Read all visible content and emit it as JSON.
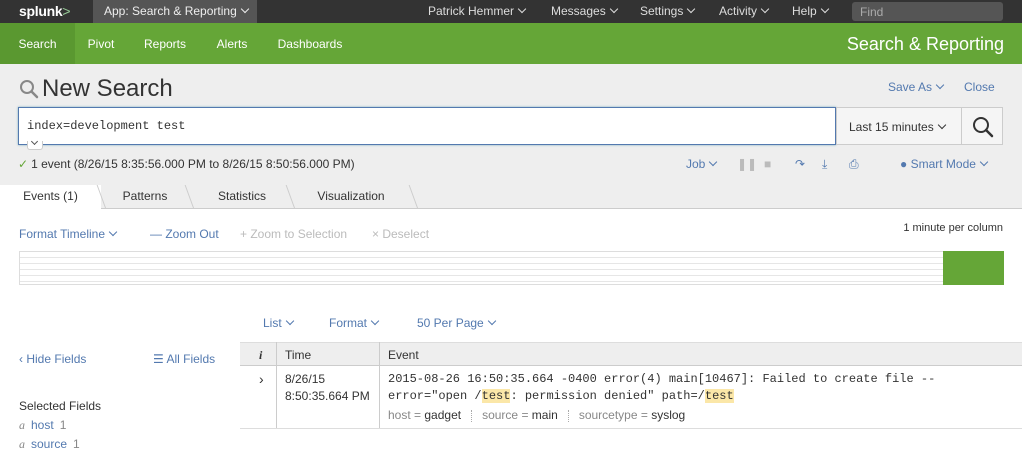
{
  "topbar": {
    "logo": "splunk",
    "logo_suffix": ">",
    "app_menu": "App: Search & Reporting",
    "nav": [
      "Patrick Hemmer",
      "Messages",
      "Settings",
      "Activity",
      "Help"
    ],
    "find_placeholder": "Find"
  },
  "appbar": {
    "tabs": [
      "Search",
      "Pivot",
      "Reports",
      "Alerts",
      "Dashboards"
    ],
    "title": "Search & Reporting"
  },
  "search": {
    "title": "New Search",
    "save_as": "Save As",
    "close": "Close",
    "query": "index=development test",
    "time_range": "Last 15 minutes",
    "status": "1 event (8/26/15 8:35:56.000 PM to 8/26/15 8:50:56.000 PM)",
    "job": "Job",
    "mode": "Smart Mode"
  },
  "tabs": [
    "Events (1)",
    "Patterns",
    "Statistics",
    "Visualization"
  ],
  "timeline": {
    "format": "Format Timeline",
    "zoom_out": "Zoom Out",
    "zoom_selection": "Zoom to Selection",
    "deselect": "Deselect",
    "scale": "1 minute per column"
  },
  "results_options": [
    "List",
    "Format",
    "50 Per Page"
  ],
  "sidebar": {
    "hide": "Hide Fields",
    "all": "All Fields",
    "selected_label": "Selected Fields",
    "fields": [
      {
        "type": "a",
        "name": "host",
        "count": "1"
      },
      {
        "type": "a",
        "name": "source",
        "count": "1"
      }
    ]
  },
  "table": {
    "headers": {
      "info": "i",
      "time": "Time",
      "event": "Event"
    },
    "rows": [
      {
        "date": "8/26/15",
        "time": "8:50:35.664 PM",
        "event_parts": [
          "2015-08-26 16:50:35.664 -0400 error(4) main[10467]: Failed to create file -- error=\"open /",
          "test",
          ": permission denied\" path=/",
          "test"
        ],
        "meta": [
          {
            "key": "host",
            "value": "gadget"
          },
          {
            "key": "source",
            "value": "main"
          },
          {
            "key": "sourcetype",
            "value": "syslog"
          }
        ]
      }
    ]
  },
  "colors": {
    "brand_green": "#65a637",
    "link_blue": "#5379af",
    "topbar": "#333333",
    "highlight": "#fbe7a8"
  }
}
